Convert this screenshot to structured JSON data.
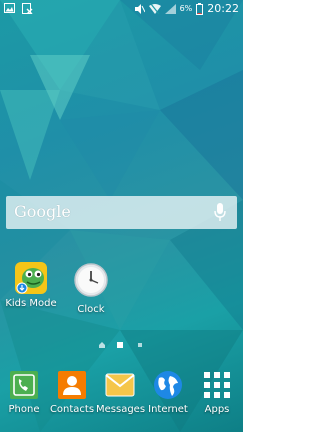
{
  "status_bar": {
    "time": "20:22",
    "battery_percent": "6%",
    "icons": [
      "gallery-icon",
      "mute-icon",
      "wifi-icon",
      "signal-icon",
      "battery-icon",
      "notification-x-icon"
    ]
  },
  "search": {
    "logo_text": "Google"
  },
  "home_apps": [
    {
      "label": "Kids Mode",
      "icon": "kids-mode-icon"
    },
    {
      "label": "Clock",
      "icon": "clock-icon"
    }
  ],
  "page_indicator": {
    "home": "home-page-icon",
    "pages": 3,
    "current": 2
  },
  "dock": [
    {
      "label": "Phone",
      "icon": "phone-icon"
    },
    {
      "label": "Contacts",
      "icon": "contacts-icon"
    },
    {
      "label": "Messages",
      "icon": "messages-icon"
    },
    {
      "label": "Internet",
      "icon": "internet-icon"
    },
    {
      "label": "Apps",
      "icon": "apps-icon"
    }
  ],
  "colors": {
    "wallpaper": "#1c9aa5",
    "phone": "#4caf50",
    "contacts": "#f57c00",
    "messages": "#f5c64a",
    "internet": "#1e88e5"
  }
}
